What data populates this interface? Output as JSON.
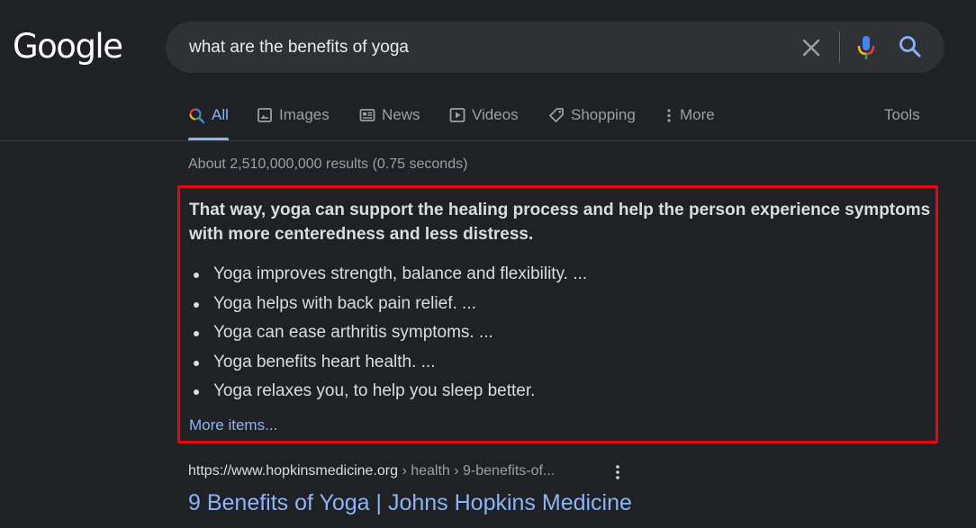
{
  "logo_text": "Google",
  "search": {
    "query": "what are the benefits of yoga"
  },
  "tabs": [
    {
      "label": "All",
      "icon": "search-multicolor-icon",
      "active": true
    },
    {
      "label": "Images",
      "icon": "image-icon"
    },
    {
      "label": "News",
      "icon": "news-icon"
    },
    {
      "label": "Videos",
      "icon": "play-icon"
    },
    {
      "label": "Shopping",
      "icon": "tag-icon"
    },
    {
      "label": "More",
      "icon": "vertical-dots-icon"
    }
  ],
  "tools_label": "Tools",
  "stats": "About 2,510,000,000 results (0.75 seconds)",
  "snippet": {
    "heading": "That way, yoga can support the healing process and help the person experience symptoms with more centeredness and less distress.",
    "items": [
      "Yoga improves strength, balance and flexibility. ...",
      "Yoga helps with back pain relief. ...",
      "Yoga can ease arthritis symptoms. ...",
      "Yoga benefits heart health. ...",
      "Yoga relaxes you, to help you sleep better."
    ],
    "more_label": "More items...",
    "highlight_color": "#e30613"
  },
  "result": {
    "domain": "https://www.hopkinsmedicine.org",
    "path": " › health › 9-benefits-of...",
    "title": "9 Benefits of Yoga | Johns Hopkins Medicine"
  },
  "colors": {
    "background": "#202124",
    "search_bg": "#303134",
    "link": "#8ab4f8",
    "text": "#dadce0",
    "muted": "#9aa0a6"
  }
}
